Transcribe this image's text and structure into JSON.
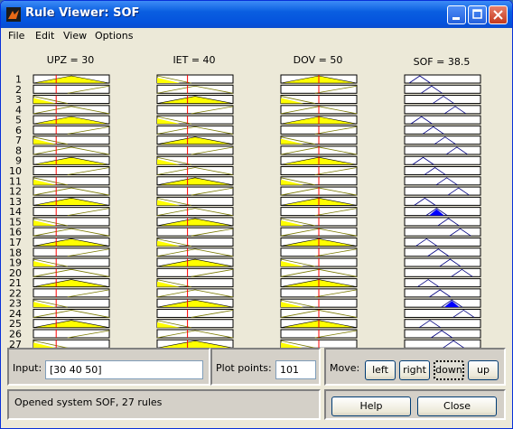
{
  "window": {
    "title": "Rule Viewer: SOF"
  },
  "menu": [
    "File",
    "Edit",
    "View",
    "Options"
  ],
  "columns": [
    {
      "title": "UPZ = 30",
      "type": "input",
      "line": 30,
      "range": [
        0,
        100
      ]
    },
    {
      "title": "IET = 40",
      "type": "input",
      "line": 40,
      "range": [
        0,
        100
      ]
    },
    {
      "title": "DOV = 50",
      "type": "input",
      "line": 50,
      "range": [
        0,
        100
      ]
    },
    {
      "title": "SOF = 38.5",
      "type": "output",
      "line": 38.5,
      "range": [
        0,
        100
      ]
    }
  ],
  "rules": [
    "1",
    "2",
    "3",
    "4",
    "5",
    "6",
    "7",
    "8",
    "9",
    "10",
    "11",
    "12",
    "13",
    "14",
    "15",
    "16",
    "17",
    "18",
    "19",
    "20",
    "21",
    "22",
    "23",
    "24",
    "25",
    "26",
    "27"
  ],
  "input": {
    "label": "Input:",
    "value": "[30 40 50]"
  },
  "plot_points": {
    "label": "Plot points:",
    "value": "101"
  },
  "move": {
    "label": "Move:",
    "buttons": [
      "left",
      "right",
      "down",
      "up"
    ]
  },
  "status": "Opened system SOF, 27 rules",
  "buttons": {
    "help": "Help",
    "close": "Close"
  },
  "colors": {
    "input_fill": "#ffff00",
    "output_fill": "#0000ff",
    "line": "#ff0000",
    "mf_line": "#000080"
  }
}
